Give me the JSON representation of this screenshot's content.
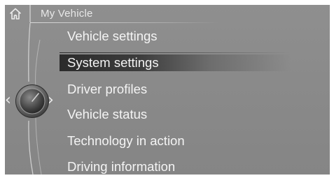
{
  "header": {
    "title": "My Vehicle",
    "home_icon": "home-icon"
  },
  "controller": {
    "icon": "idrive-controller-icon",
    "left_arrow": "‹",
    "right_arrow": "›"
  },
  "menu": {
    "selected_index": 1,
    "items": [
      {
        "label": "Vehicle settings"
      },
      {
        "label": "System settings"
      },
      {
        "label": "Driver profiles"
      },
      {
        "label": "Vehicle status"
      },
      {
        "label": "Technology in action"
      },
      {
        "label": "Driving information"
      }
    ]
  },
  "colors": {
    "background": "#8a8a8a",
    "text": "#f4f4f4",
    "selection": "#2b2b2b"
  }
}
